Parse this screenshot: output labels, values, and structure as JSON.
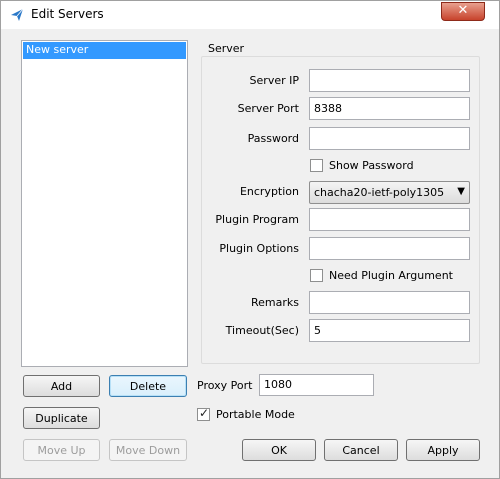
{
  "window": {
    "title": "Edit Servers",
    "close_glyph": "✕"
  },
  "server_list": {
    "items": [
      {
        "label": "New server",
        "selected": true
      }
    ]
  },
  "server_group": {
    "title": "Server",
    "fields": {
      "server_ip": {
        "label": "Server IP",
        "value": ""
      },
      "server_port": {
        "label": "Server Port",
        "value": "8388"
      },
      "password": {
        "label": "Password",
        "value": ""
      },
      "show_password": {
        "label": "Show Password",
        "checked": false
      },
      "encryption": {
        "label": "Encryption",
        "value": "chacha20-ietf-poly1305",
        "arrow": "▼"
      },
      "plugin_program": {
        "label": "Plugin Program",
        "value": ""
      },
      "plugin_options": {
        "label": "Plugin Options",
        "value": ""
      },
      "need_plugin_argument": {
        "label": "Need Plugin Argument",
        "checked": false
      },
      "remarks": {
        "label": "Remarks",
        "value": ""
      },
      "timeout": {
        "label": "Timeout(Sec)",
        "value": "5"
      }
    }
  },
  "list_buttons": {
    "add": "Add",
    "delete": "Delete",
    "duplicate": "Duplicate",
    "move_up": "Move Up",
    "move_down": "Move Down"
  },
  "proxy": {
    "label": "Proxy Port",
    "value": "1080"
  },
  "portable_mode": {
    "label": "Portable Mode",
    "checked": true
  },
  "dialog_buttons": {
    "ok": "OK",
    "cancel": "Cancel",
    "apply": "Apply"
  },
  "colors": {
    "selection": "#3399ff",
    "close_button": "#c7432c",
    "accent_icon": "#2a78c8"
  }
}
